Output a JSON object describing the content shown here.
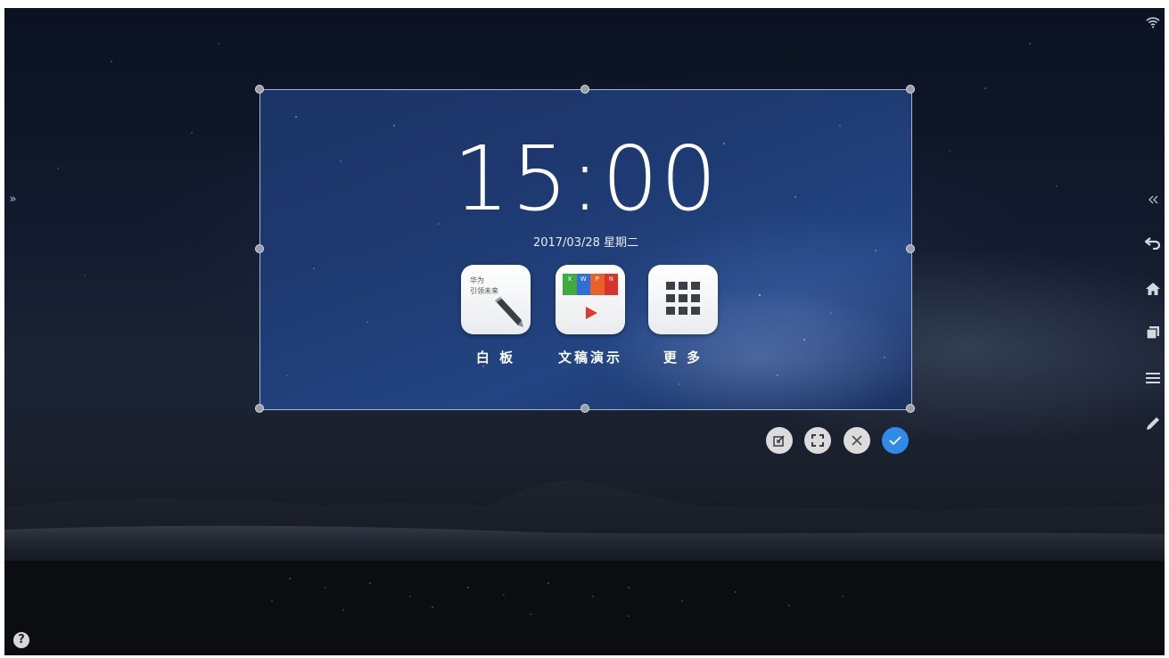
{
  "clock": {
    "time": "15:00",
    "date": "2017/03/28  星期二"
  },
  "apps": [
    {
      "label": "白 板",
      "icon": "whiteboard-icon"
    },
    {
      "label": "文稿演示",
      "icon": "presentation-icon"
    },
    {
      "label": "更 多",
      "icon": "app-grid-icon"
    }
  ],
  "whiteboard_icon_text": {
    "line1": "华为",
    "line2": "引领未来"
  },
  "presentation_icon_letters": [
    "X",
    "W",
    "P",
    "N"
  ],
  "crop_actions": [
    {
      "name": "edit-crop-button",
      "icon": "edit-icon"
    },
    {
      "name": "fullscreen-crop-button",
      "icon": "fullscreen-icon"
    },
    {
      "name": "cancel-crop-button",
      "icon": "close-icon"
    },
    {
      "name": "confirm-crop-button",
      "icon": "check-icon"
    }
  ],
  "right_toolbar": [
    "wifi-icon",
    "collapse-icon",
    "back-icon",
    "home-icon",
    "windows-icon",
    "menu-icon",
    "pen-icon"
  ],
  "colors": {
    "accent": "#2f8be6",
    "frame_bg": "#1f3b73",
    "button_gray": "#dcdcdc"
  },
  "left_expand": "»",
  "help": "?"
}
